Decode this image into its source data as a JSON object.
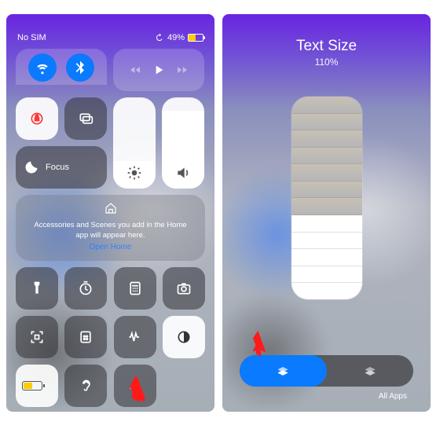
{
  "left": {
    "status": {
      "carrier": "No SIM",
      "battery_percent": "49%"
    },
    "media": {
      "playing": false
    },
    "brightness_fill_pct": 30,
    "volume_fill_pct": 85,
    "focus_label": "Focus",
    "home_card": {
      "line": "Accessories and Scenes you add in the Home app will appear here.",
      "open": "Open Home"
    }
  },
  "right": {
    "title": "Text Size",
    "percent": "110%",
    "slider_total_steps": 12,
    "slider_filled_steps": 5,
    "scope": {
      "active": "per-app",
      "all_label": "All Apps"
    }
  },
  "colors": {
    "accent": "#0a7aff",
    "arrow": "#ff1a1a",
    "battery": "#ffcc00"
  }
}
